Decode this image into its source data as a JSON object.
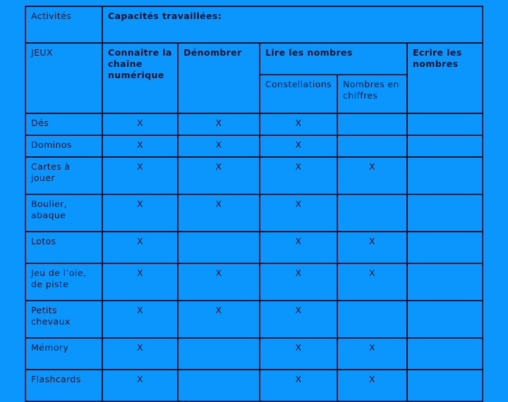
{
  "slide": {
    "background_color": "#0a96fc",
    "ink_color": "#10102e"
  },
  "table": {
    "header": {
      "activites_label": "Activités",
      "capacites_label": "Capacités travaillées:",
      "category_label": "JEUX",
      "columns": [
        "Connaître la chaîne numérique",
        "Dénombrer",
        "Lire les nombres",
        "Ecrire les nombres"
      ],
      "col_connaitre": "Connaître la chaîne numérique",
      "col_denombrer": "Dénombrer",
      "col_lire": "Lire les nombres",
      "col_ecrire": "Ecrire les nombres",
      "sub_constellations": "Constellations",
      "sub_chiffres": "Nombres en chiffres"
    },
    "mark": "X",
    "column_keys": [
      "connaitre",
      "denombrer",
      "constellations",
      "chiffres",
      "ecrire"
    ],
    "rows": [
      {
        "activity": "Dés",
        "connaitre": "X",
        "denombrer": "X",
        "constellations": "X",
        "chiffres": "",
        "ecrire": ""
      },
      {
        "activity": "Dominos",
        "connaitre": "X",
        "denombrer": "X",
        "constellations": "X",
        "chiffres": "",
        "ecrire": ""
      },
      {
        "activity": "Cartes à jouer",
        "connaitre": "X",
        "denombrer": "X",
        "constellations": "X",
        "chiffres": "X",
        "ecrire": ""
      },
      {
        "activity": "Boulier, abaque",
        "connaitre": "X",
        "denombrer": "X",
        "constellations": "X",
        "chiffres": "",
        "ecrire": ""
      },
      {
        "activity": "Lotos",
        "connaitre": "X",
        "denombrer": "",
        "constellations": "X",
        "chiffres": "X",
        "ecrire": ""
      },
      {
        "activity": "Jeu de l’oie, de piste",
        "connaitre": "X",
        "denombrer": "X",
        "constellations": "X",
        "chiffres": "X",
        "ecrire": ""
      },
      {
        "activity": "Petits chevaux",
        "connaitre": "X",
        "denombrer": "X",
        "constellations": "X",
        "chiffres": "",
        "ecrire": ""
      },
      {
        "activity": "Mémory",
        "connaitre": "X",
        "denombrer": "",
        "constellations": "X",
        "chiffres": "X",
        "ecrire": ""
      },
      {
        "activity": "Flashcards",
        "connaitre": "X",
        "denombrer": "",
        "constellations": "X",
        "chiffres": "X",
        "ecrire": ""
      }
    ]
  }
}
